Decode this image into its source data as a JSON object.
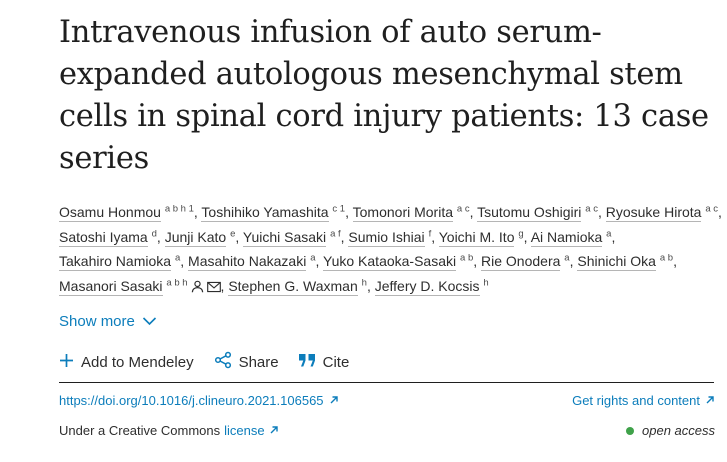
{
  "article": {
    "title": "Intravenous infusion of auto serum-expanded autologous mesenchymal stem cells in spinal cord injury patients: 13 case series"
  },
  "authors": [
    {
      "name": "Osamu Honmou",
      "aff": "a b h 1"
    },
    {
      "name": "Toshihiko Yamashita",
      "aff": "c 1"
    },
    {
      "name": "Tomonori Morita",
      "aff": "a c"
    },
    {
      "name": "Tsutomu Oshigiri",
      "aff": "a c"
    },
    {
      "name": "Ryosuke Hirota",
      "aff": "a c"
    },
    {
      "name": "Satoshi Iyama",
      "aff": "d"
    },
    {
      "name": "Junji Kato",
      "aff": "e"
    },
    {
      "name": "Yuichi Sasaki",
      "aff": "a f"
    },
    {
      "name": "Sumio Ishiai",
      "aff": "f"
    },
    {
      "name": "Yoichi M. Ito",
      "aff": "g"
    },
    {
      "name": "Ai Namioka",
      "aff": "a"
    },
    {
      "name": "Takahiro Namioka",
      "aff": "a"
    },
    {
      "name": "Masahito Nakazaki",
      "aff": "a"
    },
    {
      "name": "Yuko Kataoka-Sasaki",
      "aff": "a b"
    },
    {
      "name": "Rie Onodera",
      "aff": "a"
    },
    {
      "name": "Shinichi Oka",
      "aff": "a b"
    },
    {
      "name": "Masanori Sasaki",
      "aff": "a b h",
      "icons": [
        "person-icon",
        "envelope-icon"
      ]
    },
    {
      "name": "Stephen G. Waxman",
      "aff": "h"
    },
    {
      "name": "Jeffery D. Kocsis",
      "aff": "h"
    }
  ],
  "show_more": {
    "label": "Show more",
    "icon": "chevron-down-icon"
  },
  "actions": [
    {
      "label": "Add to Mendeley",
      "icon": "plus-icon"
    },
    {
      "label": "Share",
      "icon": "share-icon"
    },
    {
      "label": "Cite",
      "icon": "quote-icon"
    }
  ],
  "doi": {
    "label": "https://doi.org/10.1016/j.clineuro.2021.106565",
    "icon": "external-link-icon"
  },
  "rights": {
    "label": "Get rights and content",
    "icon": "external-link-icon"
  },
  "license": {
    "prefix": "Under a Creative Commons",
    "link": "license",
    "icon": "external-link-icon"
  },
  "access": {
    "label": "open access",
    "dot_color": "#3fa24a"
  },
  "colors": {
    "link": "#0c7dbb",
    "text": "#1f1f1f",
    "open_access": "#3fa24a"
  }
}
